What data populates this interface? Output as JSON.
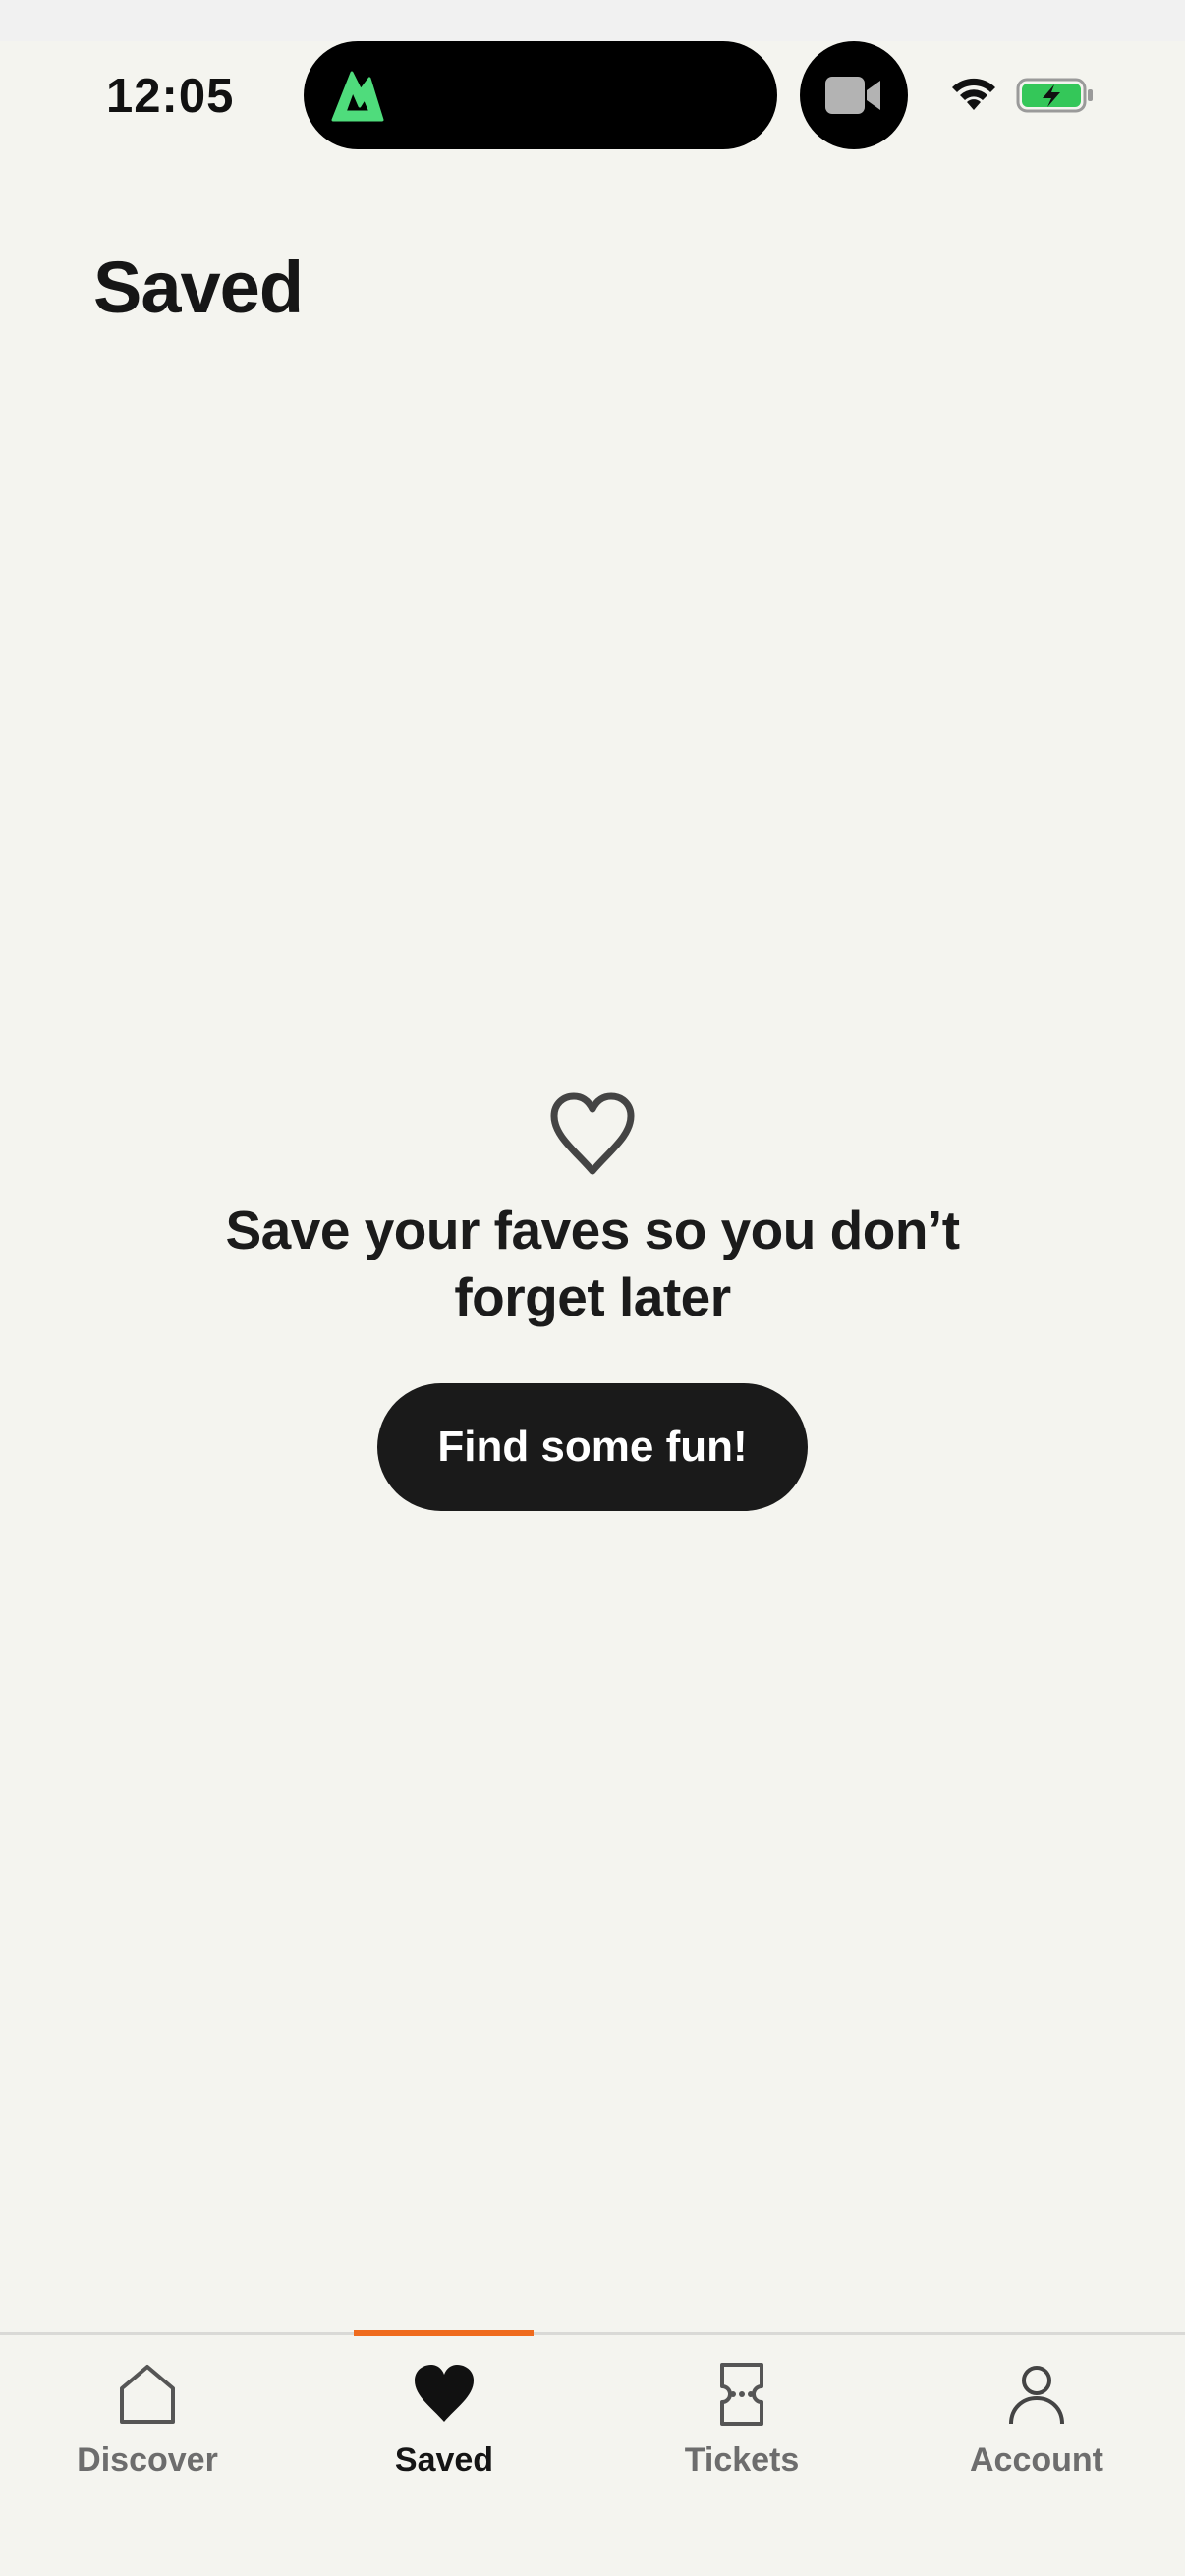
{
  "status_bar": {
    "time": "12:05",
    "battery_color": "#34c759",
    "app_icon_color": "#4fdc7c"
  },
  "header": {
    "title": "Saved"
  },
  "empty_state": {
    "icon": "heart-outline-icon",
    "message": "Save your faves so you don’t forget later",
    "button_label": "Find some fun!"
  },
  "tab_bar": {
    "active_color": "#ef6b1e",
    "tabs": [
      {
        "label": "Discover",
        "icon": "home-icon",
        "active": false
      },
      {
        "label": "Saved",
        "icon": "heart-filled-icon",
        "active": true
      },
      {
        "label": "Tickets",
        "icon": "ticket-icon",
        "active": false
      },
      {
        "label": "Account",
        "icon": "person-icon",
        "active": false
      }
    ]
  }
}
